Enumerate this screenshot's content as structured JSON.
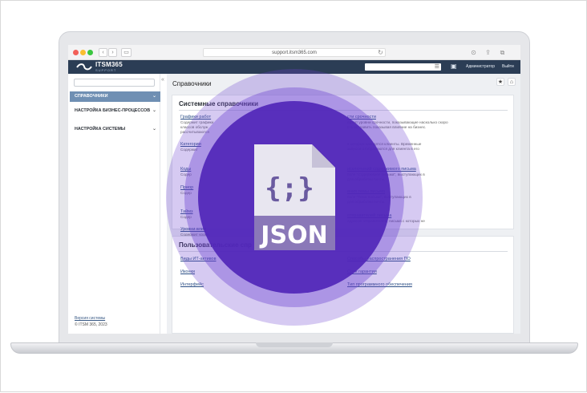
{
  "browser": {
    "url": "support.itsm365.com"
  },
  "header": {
    "logo_name": "ITSM365",
    "logo_sub": "SUPPORT",
    "user_label": "Администратор",
    "exit_label": "Выйти",
    "brand_color": "#2b3d55"
  },
  "sidebar": {
    "items": [
      {
        "label": "СПРАВОЧНИКИ"
      },
      {
        "label": "НАСТРОЙКА БИЗНЕС-ПРОЦЕССОВ"
      },
      {
        "label": "НАСТРОЙКА СИСТЕМЫ"
      }
    ],
    "version_link": "Версия системы",
    "copyright": "© ITSM 365, 2023",
    "active_color": "#6f8fb3"
  },
  "main": {
    "page_title": "Справочники",
    "system_card": {
      "title": "Системные справочники",
      "left": [
        {
          "link": "Графики работ",
          "desc": [
            "Содержит графики",
            "классов обслуж",
            "рассчитываются"
          ]
        },
        {
          "link": "Категории",
          "desc": [
            "Содержит"
          ]
        },
        {
          "link": "Коды",
          "desc": [
            "Содер"
          ]
        },
        {
          "link": "Приор",
          "desc": [
            "Содер"
          ]
        },
        {
          "link": "Таймз",
          "desc": [
            "Содер"
          ]
        },
        {
          "link": "Уровни влия",
          "desc": [
            "Содержит уровн"
          ]
        }
      ],
      "right": [
        {
          "link": "сти срочности",
          "desc": [
            "ержит уровни срочности, показывающие насколько скоро",
            "сть исправить показывая влияние на бизнес."
          ]
        },
        {
          "link": "",
          "desc": [
            "в которых находятся клиенты. Временные",
            "запроса отображаются для клиента в его"
          ]
        },
        {
          "link": "исключений содержимого письма",
          "desc": [
            "поле \"Содержимое письма\", выступающих в",
            "для обработки почты."
          ]
        },
        {
          "link": "ения темы письма",
          "desc": [
            "поле \"Тема письма\", выступающих в",
            "для обработки почты."
          ]
        },
        {
          "link": "отправителей письма",
          "desc": [
            "адресов отправителей, письма с которых не",
            ""
          ]
        }
      ]
    },
    "user_card": {
      "title": "Пользовательские спр",
      "left": [
        "Виды ИТ-активов",
        "Иконки",
        "Интерфейс"
      ],
      "right": [
        "Способы распространения ПО",
        "Срок гарантии",
        "Тип программного обеспечения"
      ]
    }
  },
  "overlay": {
    "json_label": "JSON",
    "braces_label": "{;}",
    "ring_color": "#6a3fd0",
    "core_color": "#5026b8"
  }
}
